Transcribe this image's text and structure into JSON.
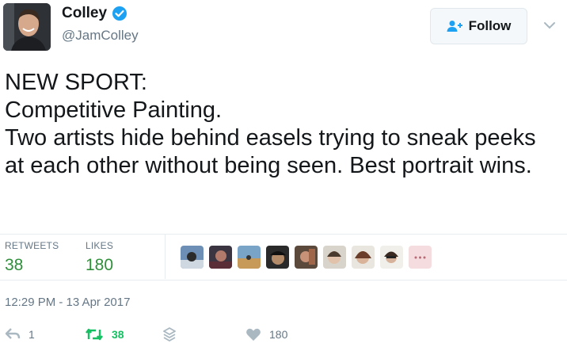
{
  "author": {
    "display_name": "Colley",
    "handle": "@JamColley",
    "verified": true
  },
  "follow_button": {
    "label": "Follow"
  },
  "tweet": {
    "text": "NEW SPORT:\nCompetitive Painting.\nTwo artists hide behind easels trying to sneak peeks at each other without being seen. Best portrait wins."
  },
  "stats": {
    "retweets_label": "RETWEETS",
    "retweets_value": "38",
    "likes_label": "LIKES",
    "likes_value": "180"
  },
  "timestamp": "12:29 PM - 13 Apr 2017",
  "actions": {
    "reply_count": "1",
    "retweet_count": "38",
    "like_count": "180"
  },
  "colors": {
    "retweet_green": "#17bf63",
    "stat_green": "#2f8f3a",
    "verified_blue": "#1da1f2",
    "muted_gray": "#657786"
  },
  "icons": [
    "verified-badge-icon",
    "add-user-icon",
    "chevron-down-icon",
    "reply-icon",
    "retweet-icon",
    "stack-icon",
    "heart-icon"
  ]
}
